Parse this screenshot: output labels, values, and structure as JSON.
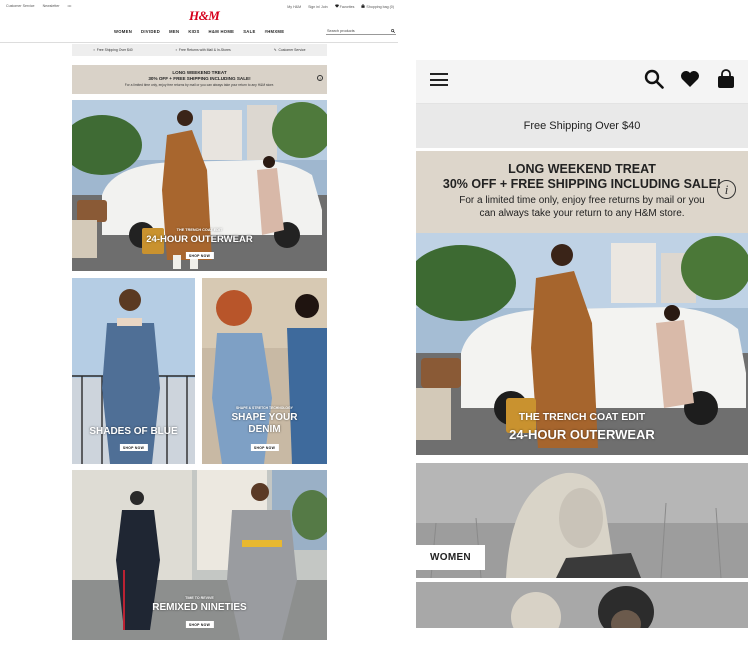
{
  "desktop": {
    "topbar": {
      "customer_service": "Customer Service",
      "newsletter": "Newsletter",
      "more": "•••",
      "my_account": "My H&M",
      "sign_in": "Sign in/ Join",
      "favorites": "Favorites",
      "bag": "Shopping bag (0)"
    },
    "logo": "H&M",
    "nav": [
      "WOMEN",
      "DIVIDED",
      "MEN",
      "KIDS",
      "H&M HOME",
      "SALE",
      "#HMXME"
    ],
    "search": {
      "placeholder": "Search products"
    },
    "promo": [
      "Free Shipping Over $40",
      "Free Returns with Mail & In-Stores",
      "Customer Service"
    ],
    "banner": {
      "title1": "LONG WEEKEND TREAT",
      "title2": "30% OFF + FREE SHIPPING INCLUDING SALE!",
      "sub": "For a limited time only, enjoy free returns by mail or you can always take your return to any H&M store.",
      "info": "i"
    },
    "hero": {
      "eyebrow": "THE TRENCH COAT EDIT",
      "title": "24-HOUR OUTERWEAR",
      "cta": "SHOP NOW"
    },
    "tile_left": {
      "title": "SHADES OF BLUE",
      "cta": "SHOP NOW"
    },
    "tile_right": {
      "eyebrow": "SHAPE & STRETCH TECHNOLOGY",
      "title1": "SHAPE YOUR",
      "title2": "DENIM",
      "cta": "SHOP NOW"
    },
    "tile_bottom": {
      "eyebrow": "TIME TO REVIVE",
      "title": "REMIXED NINETIES",
      "cta": "SHOP NOW"
    }
  },
  "mobile": {
    "shipping": "Free Shipping Over $40",
    "banner": {
      "title1": "LONG WEEKEND TREAT",
      "title2": "30% OFF + FREE SHIPPING INCLUDING SALE!",
      "sub1": "For a limited time only, enjoy free returns by mail or you",
      "sub2": "can always take your return to any H&M store.",
      "info": "i"
    },
    "hero": {
      "eyebrow": "THE TRENCH COAT EDIT",
      "title": "24-HOUR OUTERWEAR"
    },
    "women_label": "WOMEN"
  },
  "colors": {
    "brand_red": "#d6001c",
    "banner_bg": "#ddd6cb",
    "text_dark": "#222222"
  }
}
